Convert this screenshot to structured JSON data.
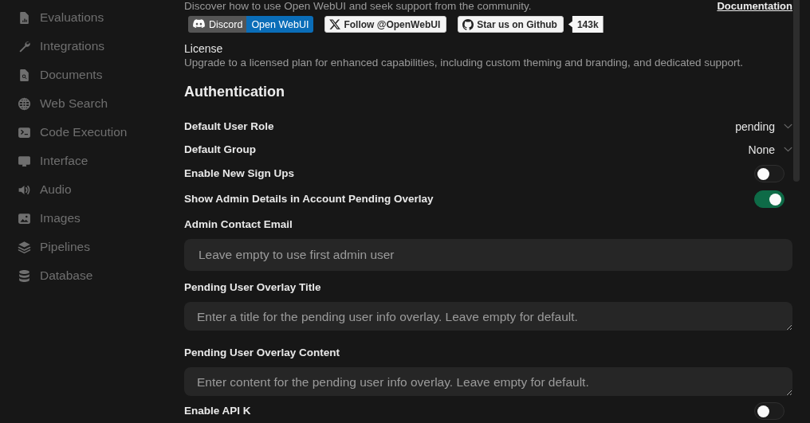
{
  "sidebar": {
    "items": [
      {
        "label": "Evaluations",
        "selected": false
      },
      {
        "label": "Integrations",
        "selected": false
      },
      {
        "label": "Documents",
        "selected": false
      },
      {
        "label": "Web Search",
        "selected": false
      },
      {
        "label": "Code Execution",
        "selected": false
      },
      {
        "label": "Interface",
        "selected": false
      },
      {
        "label": "Audio",
        "selected": false
      },
      {
        "label": "Images",
        "selected": false
      },
      {
        "label": "Pipelines",
        "selected": false
      },
      {
        "label": "Database",
        "selected": false
      }
    ]
  },
  "community": {
    "text": "Discover how to use Open WebUI and seek support from the community.",
    "link": "Documentation",
    "badges": [
      {
        "kind": "discord",
        "label": "Discord",
        "value": "Open WebUI"
      },
      {
        "kind": "x",
        "label": "Follow @OpenWebUI"
      },
      {
        "kind": "github",
        "label": "Star us on Github",
        "count": "143k"
      }
    ]
  },
  "license": {
    "title": "License",
    "text": "Upgrade to a licensed plan for enhanced capabilities, including custom theming and branding, and dedicated support."
  },
  "authentication": {
    "title": "Authentication",
    "settings": [
      {
        "kind": "select",
        "label": "Default User Role",
        "value": "pending"
      },
      {
        "kind": "select",
        "label": "Default Group",
        "value": "None"
      },
      {
        "kind": "toggle",
        "label": "Enable New Sign Ups",
        "on": false
      },
      {
        "kind": "toggle",
        "label": "Show Admin Details in Account Pending Overlay",
        "on": true
      },
      {
        "kind": "input",
        "label": "Admin Contact Email",
        "placeholder": "Leave empty to use first admin user"
      },
      {
        "kind": "textarea",
        "label": "Pending User Overlay Title",
        "placeholder": "Enter a title for the pending user info overlay. Leave empty for default."
      },
      {
        "kind": "textarea",
        "label": "Pending User Overlay Content",
        "placeholder": "Enter content for the pending user info overlay. Leave empty for default."
      },
      {
        "kind": "toggle",
        "label": "Enable API K",
        "on": false
      }
    ]
  }
}
